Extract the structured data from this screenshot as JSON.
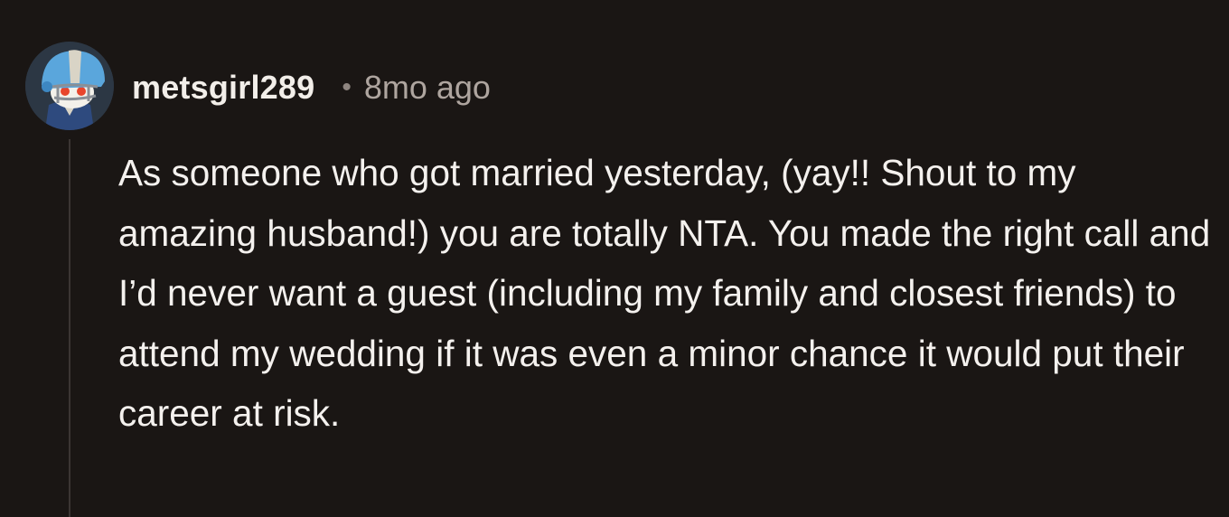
{
  "comment": {
    "username": "metsgirl289",
    "separator": "•",
    "timestamp": "8mo ago",
    "body": "As someone who got married yesterday, (yay!! Shout to my amazing husband!) you are totally NTA. You made the right call and I’d never want a guest (including my family and closest friends) to attend my wedding if it was even a minor chance it would put their career at risk."
  },
  "avatar": {
    "icon": "snoo-football-helmet-avatar",
    "colors": {
      "background": "#2c3744",
      "helmet": "#5aa6dc",
      "stripe": "#d9d4c6",
      "jersey": "#2e4a7e",
      "eyes": "#e8452c"
    }
  },
  "colors": {
    "background": "#1a1614",
    "username": "#f2eee9",
    "timestamp": "#aea59f",
    "body": "#f4f1ee",
    "thread_line": "#3b3533"
  }
}
